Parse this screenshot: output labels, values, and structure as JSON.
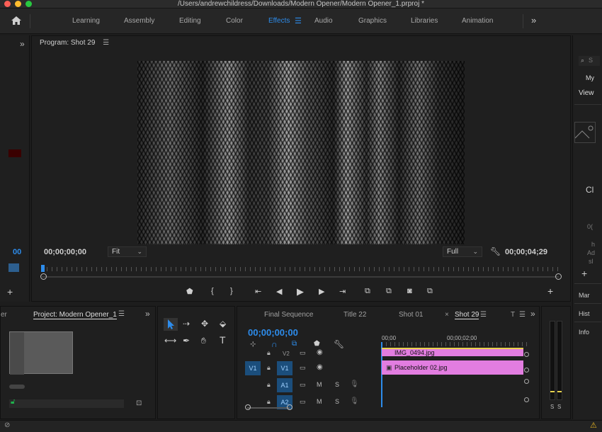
{
  "window": {
    "title": "/Users/andrewchildress/Downloads/Modern Opener/Modern Opener_1.prproj *"
  },
  "workspaces": {
    "items": [
      "Learning",
      "Assembly",
      "Editing",
      "Color",
      "Effects",
      "Audio",
      "Graphics",
      "Libraries",
      "Animation"
    ],
    "active": "Effects"
  },
  "program": {
    "title": "Program: Shot 29",
    "timecode_current": "00;00;00;00",
    "timecode_duration": "00;00;04;29",
    "fit": "Fit",
    "resolution": "Full"
  },
  "left_col": {
    "timecode": "00"
  },
  "project": {
    "tab_prefix": "er",
    "title": "Project: Modern Opener_1"
  },
  "timeline": {
    "tabs": [
      "Final Sequence",
      "Title 22",
      "Shot 01",
      "Shot 29",
      "T"
    ],
    "active_tab": "Shot 29",
    "timecode": "00;00;00;00",
    "ruler": [
      "00;00",
      "00;00;02;00"
    ],
    "tracks": [
      {
        "name": "V2",
        "clip": "IMG_0494.jpg"
      },
      {
        "name": "V1",
        "source": "V1",
        "clip": "Placeholder 02.jpg"
      },
      {
        "name": "A1",
        "m": "M",
        "s": "S"
      },
      {
        "name": "A2",
        "m": "M",
        "s": "S"
      }
    ]
  },
  "right_col": {
    "search_placeholder": "S",
    "my_label": "My",
    "view_label": "View",
    "ch_label": "Cl",
    "zero": "0(",
    "h_label": "h",
    "ad_label": "Ad",
    "sl_label": "sl",
    "items": [
      "Mar",
      "Hist",
      "Info"
    ]
  },
  "meters": {
    "labels": [
      "S",
      "S"
    ]
  },
  "colors": {
    "accent": "#2d8ceb",
    "clip_pink": "#e27de0",
    "track_toggle": "#1b4e7c"
  }
}
